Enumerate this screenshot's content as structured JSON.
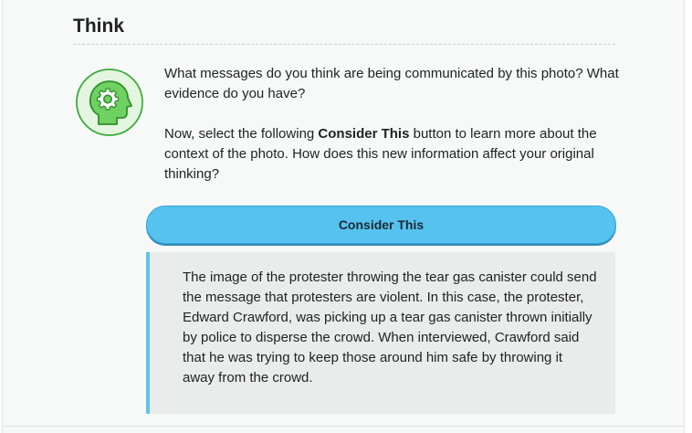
{
  "section": {
    "heading": "Think"
  },
  "icon": {
    "name": "head-gear-icon",
    "accent": "#3daa3a",
    "fill": "#e4f6df"
  },
  "prompt": {
    "question": "What messages do you think are being communicated by this photo? What evidence do you have?",
    "instruction_before": "Now, select the following ",
    "instruction_bold": "Consider This",
    "instruction_after": " button to learn more about the context of the photo. How does this new information affect your original thinking?"
  },
  "consider_button": {
    "label": "Consider This",
    "color": "#55c2ef"
  },
  "reveal": {
    "text": "The image of the protester throwing the tear gas canister could send the message that protesters are violent. In this case, the protester, Edward Crawford, was picking up a tear gas canister thrown initially by police to disperse the crowd. When interviewed, Crawford said that he was trying to keep those around him safe by throwing it away from the crowd.",
    "border_color": "#5fc3ee"
  }
}
